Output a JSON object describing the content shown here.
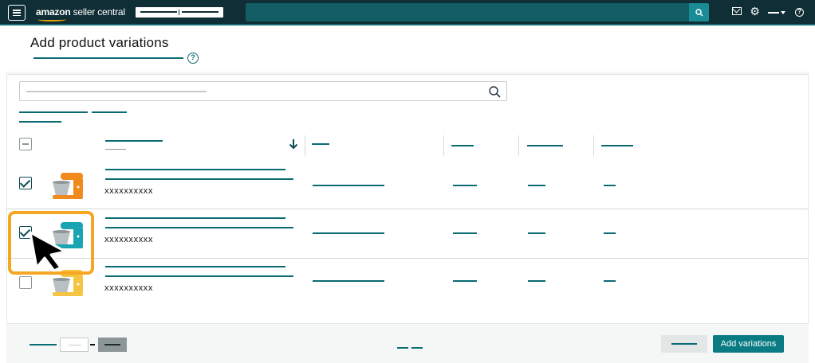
{
  "app": {
    "brand_prefix": "amazon",
    "brand_suffix": " seller central"
  },
  "header": {
    "title": "Add product variations",
    "help_glyph": "?"
  },
  "footer": {
    "add_variations_label": "Add variations"
  },
  "rows": [
    {
      "sku": "xxxxxxxxxx",
      "checked": true,
      "product_color": "#f08a1c"
    },
    {
      "sku": "xxxxxxxxxx",
      "checked": true,
      "product_color": "#1aa3b0"
    },
    {
      "sku": "xxxxxxxxxx",
      "checked": false,
      "product_color": "#f5c542"
    }
  ],
  "colors": {
    "nav_bg": "#0f2e35",
    "accent_teal": "#0a6b74",
    "primary_button": "#0a7b83",
    "highlight": "#f5a623"
  },
  "icons": [
    "menu-icon",
    "search-icon",
    "mail-icon",
    "gear-icon",
    "help-icon",
    "sort-down-arrow-icon",
    "mouse-pointer-icon"
  ]
}
